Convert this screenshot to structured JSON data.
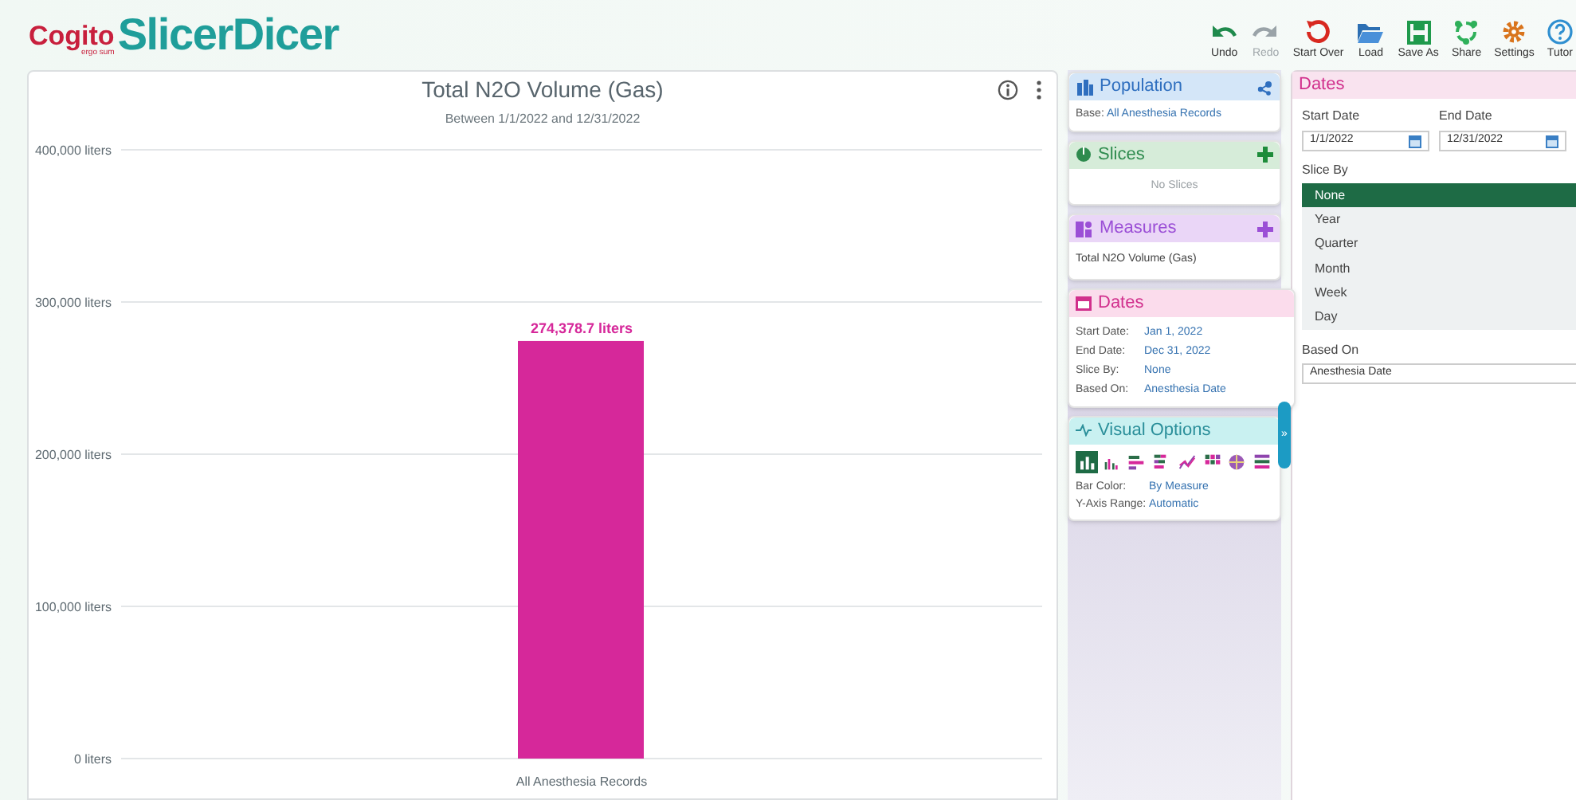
{
  "logo": {
    "brand": "Cogito",
    "motto": "ergo sum",
    "product": "SlicerDicer"
  },
  "toolbar": [
    {
      "kind": "undo",
      "label": "Undo",
      "disabled": false
    },
    {
      "kind": "redo",
      "label": "Redo",
      "disabled": true
    },
    {
      "kind": "start-over",
      "label": "Start Over",
      "disabled": false
    },
    {
      "kind": "load",
      "label": "Load",
      "disabled": false
    },
    {
      "kind": "save",
      "label": "Save As",
      "disabled": false
    },
    {
      "kind": "share",
      "label": "Share",
      "disabled": false
    },
    {
      "kind": "settings",
      "label": "Settings",
      "disabled": false
    },
    {
      "kind": "help",
      "label": "Tutor",
      "disabled": false
    }
  ],
  "chart_card": {
    "title": "Total N2O Volume (Gas)",
    "subtitle": "Between 1/1/2022 and 12/31/2022",
    "chart_data": {
      "type": "bar",
      "categories": [
        "All Anesthesia Records"
      ],
      "series": [
        {
          "color": "#d6289a",
          "values": [
            274378.7
          ]
        }
      ],
      "ylim": [
        0,
        400000
      ],
      "grid": true,
      "yticks": [
        {
          "value": 0,
          "label": "0 liters"
        },
        {
          "value": 100000,
          "label": "100,000 liters"
        },
        {
          "value": 200000,
          "label": "200,000 liters"
        },
        {
          "value": 300000,
          "label": "300,000 liters"
        },
        {
          "value": 400000,
          "label": "400,000 liters"
        }
      ],
      "value_labels": [
        "274,378.7 liters"
      ]
    }
  },
  "population": {
    "title": "Population",
    "base_label": "Base:",
    "base_value": "All Anesthesia Records"
  },
  "slices": {
    "title": "Slices",
    "empty": "No Slices"
  },
  "measures": {
    "title": "Measures",
    "items": [
      "Total N2O Volume (Gas)"
    ]
  },
  "dates_summary": {
    "title": "Dates",
    "rows": [
      {
        "label": "Start Date:",
        "value": "Jan 1, 2022"
      },
      {
        "label": "End Date:",
        "value": "Dec 31, 2022"
      },
      {
        "label": "Slice By:",
        "value": "None"
      },
      {
        "label": "Based On:",
        "value": "Anesthesia Date"
      }
    ]
  },
  "visual_options": {
    "title": "Visual Options",
    "chart_types": [
      {
        "selected": true
      },
      {
        "selected": false
      },
      {
        "selected": false
      },
      {
        "selected": false
      },
      {
        "selected": false
      },
      {
        "selected": false
      },
      {
        "selected": false
      },
      {
        "selected": false
      }
    ],
    "rows": [
      {
        "label": "Bar Color:",
        "value": "By Measure"
      },
      {
        "label": "Y-Axis Range:",
        "value": "Automatic"
      }
    ]
  },
  "expand_handle": {
    "label": "»"
  },
  "dates_editor": {
    "title": "Dates",
    "start_label": "Start Date",
    "start_value": "1/1/2022",
    "end_label": "End Date",
    "end_value": "12/31/2022",
    "slice_by_label": "Slice By",
    "slice_options": [
      {
        "label": "None",
        "selected": true
      },
      {
        "label": "Year",
        "selected": false
      },
      {
        "label": "Quarter",
        "selected": false
      },
      {
        "label": "Month",
        "selected": false
      },
      {
        "label": "Week",
        "selected": false
      },
      {
        "label": "Day",
        "selected": false
      }
    ],
    "based_on_label": "Based On",
    "based_on_value": "Anesthesia Date"
  }
}
